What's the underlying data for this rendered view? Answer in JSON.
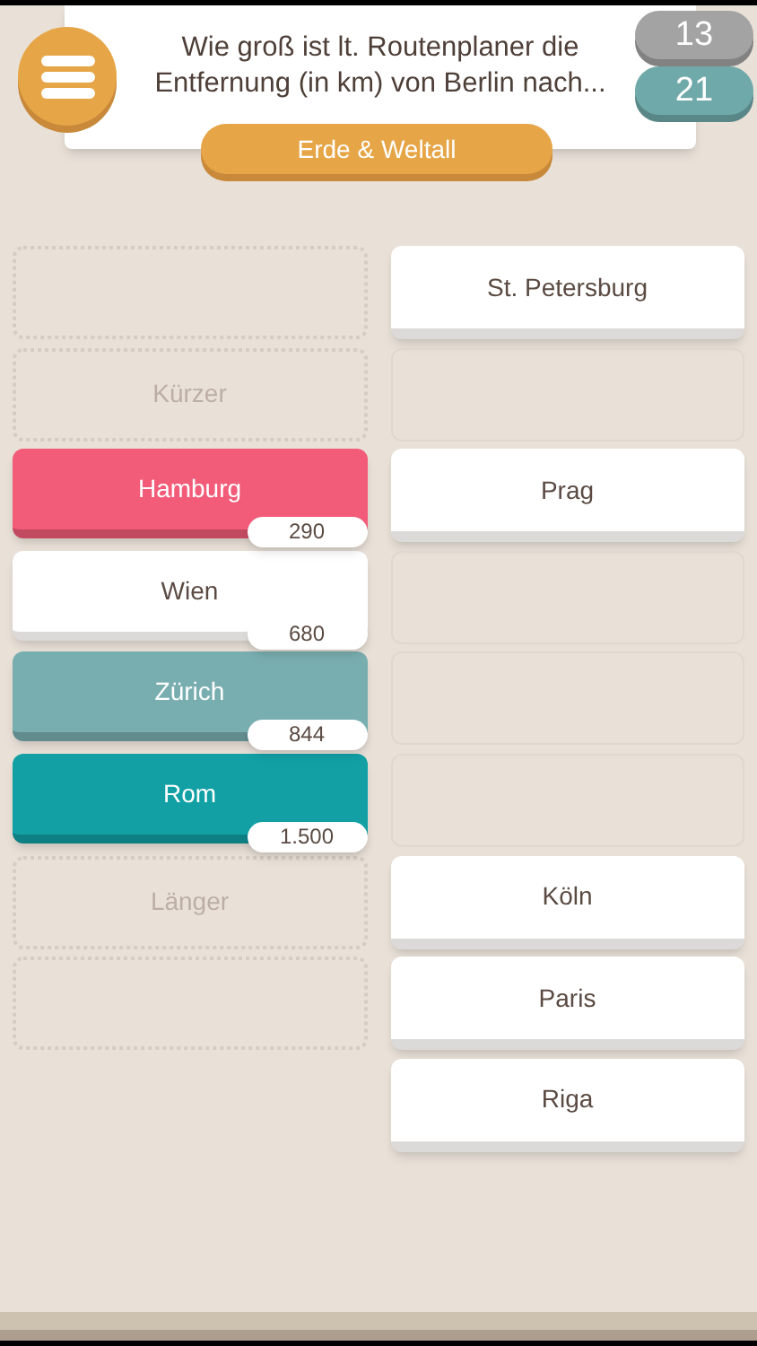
{
  "question": "Wie groß ist lt. Routenplaner die Entfernung (in km) von Berlin nach...",
  "scores": [
    {
      "value": "13",
      "color": "#a3a3a3"
    },
    {
      "value": "21",
      "color": "#6fa9a9"
    }
  ],
  "category": "Erde & Weltall",
  "order_slots": [
    {
      "kind": "empty"
    },
    {
      "kind": "label",
      "text": "Kürzer"
    },
    {
      "kind": "answer",
      "name": "Hamburg",
      "value": "290",
      "color": "#f25c79"
    },
    {
      "kind": "answer",
      "name": "Wien",
      "value": "680",
      "color": "#ffffff"
    },
    {
      "kind": "answer",
      "name": "Zürich",
      "value": "844",
      "color": "#79aeb0"
    },
    {
      "kind": "answer",
      "name": "Rom",
      "value": "1.500",
      "color": "#12a0a5"
    },
    {
      "kind": "label",
      "text": "Länger"
    },
    {
      "kind": "empty"
    }
  ],
  "choices": [
    {
      "kind": "card",
      "name": "St. Petersburg"
    },
    {
      "kind": "empty"
    },
    {
      "kind": "card",
      "name": "Prag"
    },
    {
      "kind": "empty"
    },
    {
      "kind": "empty"
    },
    {
      "kind": "empty"
    },
    {
      "kind": "card",
      "name": "Köln"
    },
    {
      "kind": "card",
      "name": "Paris"
    },
    {
      "kind": "card",
      "name": "Riga"
    }
  ]
}
